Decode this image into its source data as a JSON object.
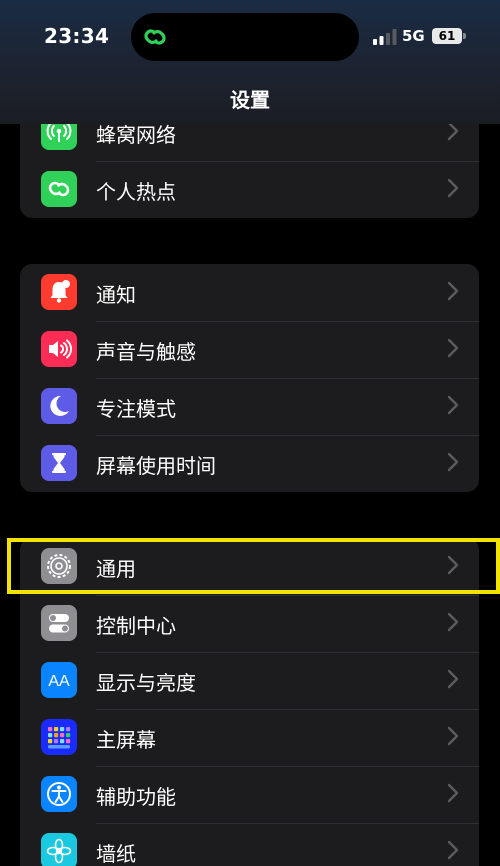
{
  "status_bar": {
    "time": "23:34",
    "network": "5G",
    "battery_level": "61",
    "signal_bars_active": 2,
    "signal_bars_total": 4
  },
  "nav": {
    "title": "设置"
  },
  "groups": [
    {
      "items": [
        {
          "label": "蜂窝网络",
          "icon": "cellular-antenna-icon",
          "color": "#30d158"
        },
        {
          "label": "个人热点",
          "icon": "personal-hotspot-icon",
          "color": "#30d158"
        }
      ]
    },
    {
      "items": [
        {
          "label": "通知",
          "icon": "notification-bell-icon",
          "color": "#ff3b30"
        },
        {
          "label": "声音与触感",
          "icon": "speaker-icon",
          "color": "#ff2d55"
        },
        {
          "label": "专注模式",
          "icon": "moon-icon",
          "color": "#5e5ce6"
        },
        {
          "label": "屏幕使用时间",
          "icon": "hourglass-icon",
          "color": "#5e5ce6"
        }
      ]
    },
    {
      "items": [
        {
          "label": "通用",
          "icon": "gear-icon",
          "color": "#8e8e93"
        },
        {
          "label": "控制中心",
          "icon": "toggle-switches-icon",
          "color": "#8e8e93"
        },
        {
          "label": "显示与亮度",
          "icon": "text-size-icon",
          "color": "#0a84ff"
        },
        {
          "label": "主屏幕",
          "icon": "app-grid-icon",
          "color": "#0a3dff"
        },
        {
          "label": "辅助功能",
          "icon": "accessibility-icon",
          "color": "#0a84ff"
        },
        {
          "label": "墙纸",
          "icon": "flower-icon",
          "color": "#1ac8e0"
        }
      ]
    }
  ],
  "icon_text": {
    "display_aa": "AA"
  },
  "highlighted_item": "通用",
  "highlight_color": "#f2e400"
}
